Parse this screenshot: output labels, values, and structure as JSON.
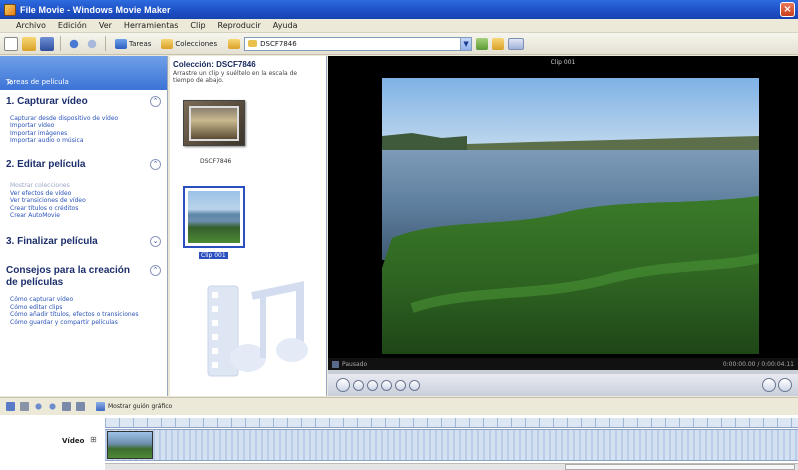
{
  "window": {
    "title": "File Movie - Windows Movie Maker"
  },
  "menubar": {
    "items": [
      "Archivo",
      "Edición",
      "Ver",
      "Herramientas",
      "Clip",
      "Reproducir",
      "Ayuda"
    ]
  },
  "toolbar": {
    "tasks_label": "Tareas",
    "collections_label": "Colecciones",
    "collection_select_value": "DSCF7846"
  },
  "taskpane": {
    "header": "Tareas de película",
    "sections": [
      {
        "title": "1. Capturar vídeo",
        "links": [
          "Capturar desde dispositivo de vídeo",
          "Importar vídeo",
          "Importar imágenes",
          "Importar audio o música"
        ]
      },
      {
        "title": "2. Editar película",
        "links": [
          "Mostrar colecciones",
          "Ver efectos de vídeo",
          "Ver transiciones de vídeo",
          "Crear títulos o créditos",
          "Crear AutoMovie"
        ]
      },
      {
        "title": "3. Finalizar película",
        "links": []
      },
      {
        "title": "Consejos para la creación de películas",
        "links": [
          "Cómo capturar vídeo",
          "Cómo editar clips",
          "Cómo añadir títulos, efectos o transiciones",
          "Cómo guardar y compartir películas"
        ]
      }
    ]
  },
  "collection": {
    "title": "Colección: DSCF7846",
    "description": "Arrastre un clip y suéltelo en la escala de tiempo de abajo.",
    "clips": [
      {
        "label": "DSCF7846"
      },
      {
        "label": "Clip 001"
      }
    ]
  },
  "preview": {
    "title": "Clip 001",
    "status": "Pausado",
    "time": "0:00:00.00 / 0:00:04.11"
  },
  "timeline": {
    "storyboard_label": "Mostrar guión gráfico",
    "track_label": "Vídeo"
  },
  "colors": {
    "titlebar": "#1d4fc4",
    "taskpane_header": "#3c73d6",
    "link": "#2a53b7",
    "section_title": "#1c2e6b"
  }
}
